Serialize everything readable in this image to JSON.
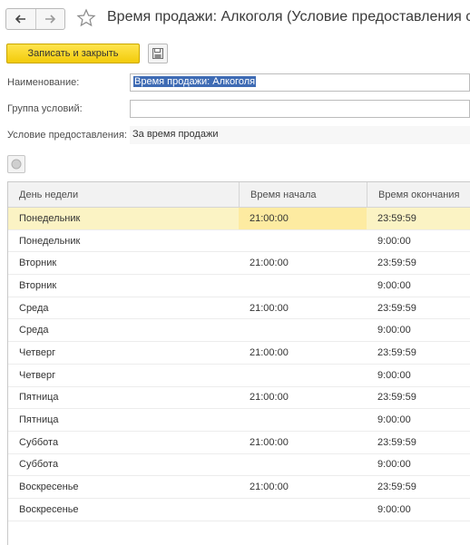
{
  "window": {
    "title": "Время продажи: Алкоголя (Условие предоставления с",
    "back_icon": "arrow-left-icon",
    "forward_icon": "arrow-right-icon",
    "favorite_icon": "star-icon"
  },
  "toolbar": {
    "save_close_label": "Записать и закрыть",
    "save_icon": "floppy-disk-icon"
  },
  "form": {
    "name_label": "Наименование:",
    "name_value": "Время продажи: Алкоголя",
    "group_label": "Группа условий:",
    "group_value": "",
    "condition_label": "Условие предоставления:",
    "condition_value": "За время продажи"
  },
  "table": {
    "headers": [
      "День недели",
      "Время начала",
      "Время окончания"
    ],
    "rows": [
      {
        "day": "Понедельник",
        "start": "21:00:00",
        "end": "23:59:59"
      },
      {
        "day": "Понедельник",
        "start": "",
        "end": "9:00:00"
      },
      {
        "day": "Вторник",
        "start": "21:00:00",
        "end": "23:59:59"
      },
      {
        "day": "Вторник",
        "start": "",
        "end": "9:00:00"
      },
      {
        "day": "Среда",
        "start": "21:00:00",
        "end": "23:59:59"
      },
      {
        "day": "Среда",
        "start": "",
        "end": "9:00:00"
      },
      {
        "day": "Четверг",
        "start": "21:00:00",
        "end": "23:59:59"
      },
      {
        "day": "Четверг",
        "start": "",
        "end": "9:00:00"
      },
      {
        "day": "Пятница",
        "start": "21:00:00",
        "end": "23:59:59"
      },
      {
        "day": "Пятница",
        "start": "",
        "end": "9:00:00"
      },
      {
        "day": "Суббота",
        "start": "21:00:00",
        "end": "23:59:59"
      },
      {
        "day": "Суббота",
        "start": "",
        "end": "9:00:00"
      },
      {
        "day": "Воскресенье",
        "start": "21:00:00",
        "end": "23:59:59"
      },
      {
        "day": "Воскресенье",
        "start": "",
        "end": "9:00:00"
      }
    ],
    "selected_row": 0
  },
  "colors": {
    "accent_button": "#f5d21c",
    "selection": "#3e6bb4",
    "selected_row": "#fbf3c4"
  }
}
